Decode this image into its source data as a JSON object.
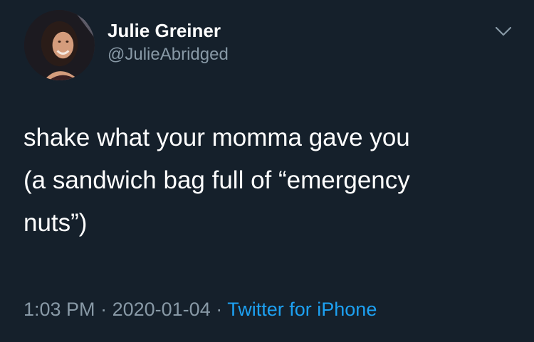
{
  "author": {
    "display_name": "Julie Greiner",
    "handle": "@JulieAbridged"
  },
  "tweet": {
    "lines": [
      "shake what your momma gave you",
      "(a sandwich bag full of “emergency",
      "nuts”)"
    ]
  },
  "meta": {
    "time": "1:03 PM",
    "separator": "·",
    "date": "2020-01-04",
    "source": "Twitter for iPhone"
  },
  "colors": {
    "background": "#15202b",
    "text": "#ffffff",
    "secondary": "#8899a6",
    "link": "#1da1f2"
  },
  "icons": {
    "menu": "chevron-down-icon"
  }
}
